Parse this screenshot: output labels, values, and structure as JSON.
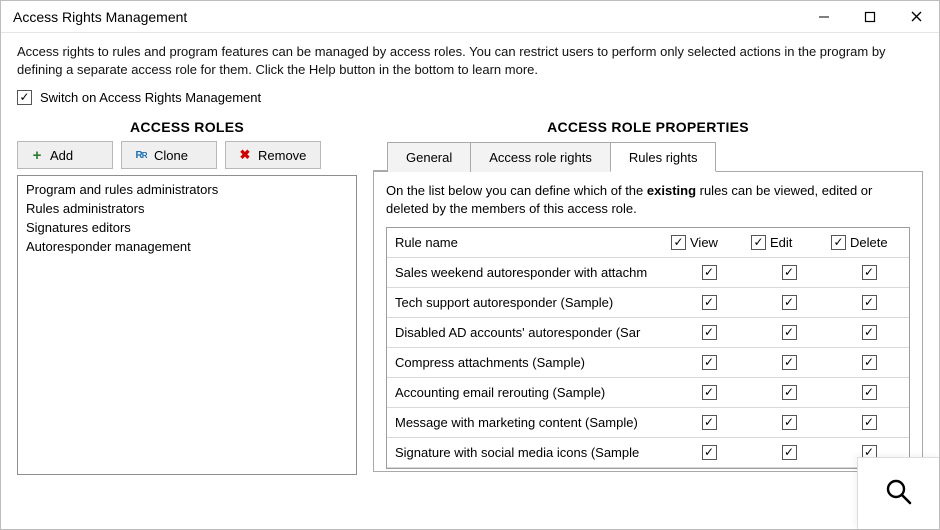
{
  "window": {
    "title": "Access Rights Management"
  },
  "intro": "Access rights to rules and program features can be managed by access roles. You can restrict users to perform only selected actions in the program by defining a separate access role for them. Click the Help button in the bottom to learn more.",
  "main_switch": {
    "label": "Switch on Access Rights Management",
    "checked": true
  },
  "left": {
    "heading": "ACCESS ROLES",
    "buttons": {
      "add": "Add",
      "clone": "Clone",
      "remove": "Remove"
    },
    "roles": [
      "Program and rules administrators",
      "Rules administrators",
      "Signatures editors",
      "Autoresponder management"
    ]
  },
  "right": {
    "heading": "ACCESS ROLE PROPERTIES",
    "tabs": {
      "general": "General",
      "role_rights": "Access role rights",
      "rules_rights": "Rules rights"
    },
    "panel": {
      "desc_pre": "On the list below you can define which of the ",
      "desc_bold": "existing",
      "desc_post": " rules can be viewed, edited or deleted by the members of this access role.",
      "columns": {
        "name": "Rule name",
        "view": "View",
        "edit": "Edit",
        "delete": "Delete"
      },
      "header_checked": {
        "view": true,
        "edit": true,
        "delete": true
      },
      "rows": [
        {
          "name": "Sales weekend autoresponder with attachm",
          "view": true,
          "edit": true,
          "delete": true
        },
        {
          "name": "Tech support autoresponder (Sample)",
          "view": true,
          "edit": true,
          "delete": true
        },
        {
          "name": "Disabled AD accounts' autoresponder (Sar",
          "view": true,
          "edit": true,
          "delete": true
        },
        {
          "name": "Compress attachments (Sample)",
          "view": true,
          "edit": true,
          "delete": true
        },
        {
          "name": "Accounting email rerouting (Sample)",
          "view": true,
          "edit": true,
          "delete": true
        },
        {
          "name": "Message with marketing content (Sample)",
          "view": true,
          "edit": true,
          "delete": true
        },
        {
          "name": "Signature with social media icons (Sample",
          "view": true,
          "edit": true,
          "delete": true
        }
      ]
    }
  }
}
